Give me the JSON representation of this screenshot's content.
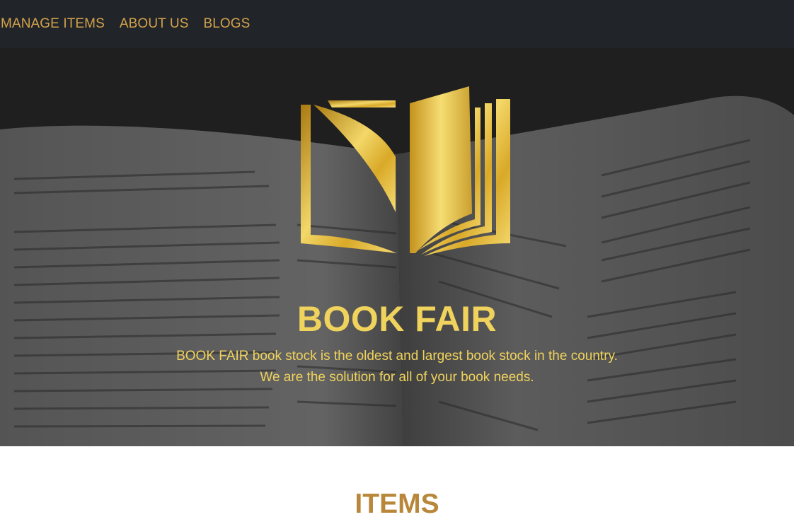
{
  "nav": {
    "links": [
      {
        "label": "MANAGE ITEMS"
      },
      {
        "label": "ABOUT US"
      },
      {
        "label": "BLOGS"
      }
    ]
  },
  "hero": {
    "logo_icon": "open-book-logo-icon",
    "title": "BOOK FAIR",
    "desc_line1": "BOOK FAIR book stock is the oldest and largest book stock in the country.",
    "desc_line2": "We are the solution for all of your book needs."
  },
  "items_section": {
    "heading": "ITEMS"
  },
  "colors": {
    "navbar_bg": "#212529",
    "nav_link": "#d4a24c",
    "hero_text": "#f0d35c",
    "heading": "#b9873a"
  }
}
